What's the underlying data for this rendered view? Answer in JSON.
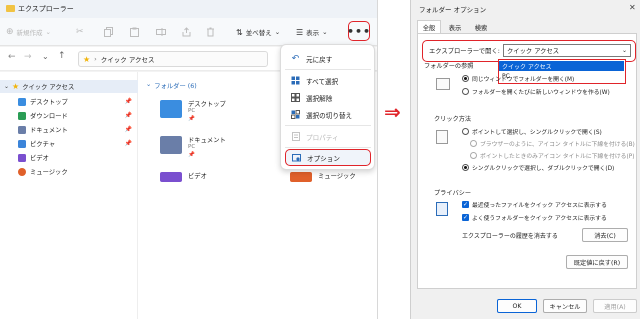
{
  "explorer": {
    "title": "エクスプローラー",
    "toolbar": {
      "new_label": "新規作成",
      "sort_label": "並べ替え",
      "view_label": "表示",
      "more_label": "•••"
    },
    "address": {
      "path": "クイック アクセス"
    },
    "nav": {
      "quick_access": "クイック アクセス",
      "items": [
        {
          "label": "デスクトップ",
          "color": "#3a8de0"
        },
        {
          "label": "ダウンロード",
          "color": "#2a9d55"
        },
        {
          "label": "ドキュメント",
          "color": "#6a7ea8"
        },
        {
          "label": "ピクチャ",
          "color": "#3b84d9"
        },
        {
          "label": "ビデオ",
          "color": "#7a4fcf"
        },
        {
          "label": "ミュージック",
          "color": "#e0602a"
        }
      ]
    },
    "content": {
      "section_label": "フォルダー (6)",
      "folders": [
        {
          "name": "デスクトップ",
          "sub": "PC",
          "color": "#3a8de0"
        },
        {
          "name": "ドキュメント",
          "sub": "PC",
          "color": "#6a7ea8"
        },
        {
          "name": "ビデオ",
          "sub": "",
          "color": "#7a4fcf"
        },
        {
          "name": "ミュージック",
          "sub": "",
          "color": "#e0602a"
        }
      ]
    },
    "menu": {
      "items": [
        {
          "label": "元に戻す",
          "icon": "undo-icon",
          "disabled": false
        },
        {
          "label": "すべて選択",
          "icon": "select-all-icon",
          "disabled": false
        },
        {
          "label": "選択解除",
          "icon": "select-none-icon",
          "disabled": false
        },
        {
          "label": "選択の切り替え",
          "icon": "invert-selection-icon",
          "disabled": false
        },
        {
          "label": "プロパティ",
          "icon": "properties-icon",
          "disabled": true
        },
        {
          "label": "オプション",
          "icon": "options-icon",
          "disabled": false
        }
      ]
    }
  },
  "arrow": "⇒",
  "dialog": {
    "title": "フォルダー オプション",
    "close": "✕",
    "tabs": [
      "全般",
      "表示",
      "検索"
    ],
    "open_label": "エクスプローラーで開く:",
    "open_value": "クイック アクセス",
    "open_options": [
      "クイック アクセス",
      "PC"
    ],
    "browse_label": "フォルダーの参照",
    "browse_options": [
      "同じウィンドウでフォルダーを開く(M)",
      "フォルダーを開くたびに新しいウィンドウを作る(W)"
    ],
    "click_label": "クリック方法",
    "click_options": [
      "ポイントして選択し、シングルクリックで開く(S)",
      "ブラウザーのように、アイコン タイトルに下線を付ける(B)",
      "ポイントしたときのみアイコン タイトルに下線を付ける(P)",
      "シングルクリックで選択し、ダブルクリックで開く(D)"
    ],
    "privacy_label": "プライバシー",
    "privacy_options": [
      "最近使ったファイルをクイック アクセスに表示する",
      "よく使うフォルダーをクイック アクセスに表示する"
    ],
    "clear_history_label": "エクスプローラーの履歴を消去する",
    "clear_button": "消去(C)",
    "restore_button": "既定値に戻す(R)",
    "ok_button": "OK",
    "cancel_button": "キャンセル",
    "apply_button": "適用(A)",
    "colors": {
      "accent": "#0a64d6",
      "highlight": "#e0242a"
    }
  }
}
